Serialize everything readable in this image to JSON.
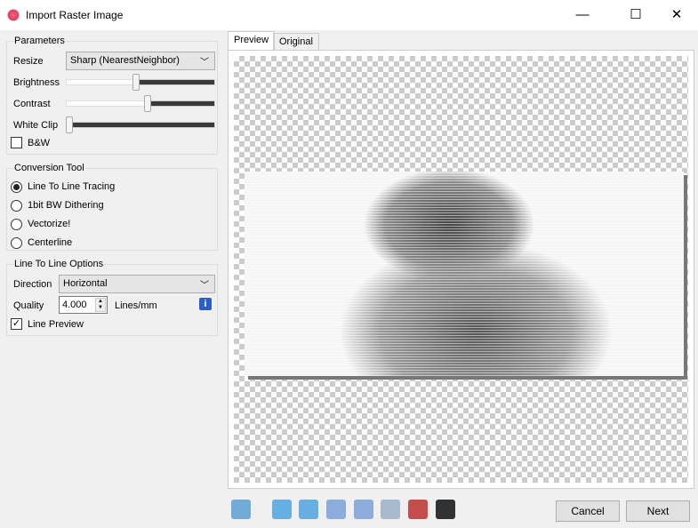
{
  "window": {
    "title": "Import Raster Image",
    "minimize": "—",
    "maximize": "☐",
    "close": "✕"
  },
  "parameters": {
    "label": "Parameters",
    "resize_label": "Resize",
    "resize_value": "Sharp (NearestNeighbor)",
    "brightness_label": "Brightness",
    "brightness_percent": 47,
    "contrast_label": "Contrast",
    "contrast_percent": 55,
    "whiteclip_label": "White Clip",
    "whiteclip_percent": 0,
    "bw_label": "B&W",
    "bw_checked": false
  },
  "conversion": {
    "label": "Conversion Tool",
    "options": [
      "Line To Line Tracing",
      "1bit BW Dithering",
      "Vectorize!",
      "Centerline"
    ],
    "selected": 0
  },
  "line_options": {
    "label": "Line To Line Options",
    "direction_label": "Direction",
    "direction_value": "Horizontal",
    "quality_label": "Quality",
    "quality_value": "4.000",
    "quality_unit": "Lines/mm",
    "line_preview_label": "Line Preview",
    "line_preview_checked": true
  },
  "tabs": [
    "Preview",
    "Original"
  ],
  "toolbar": {
    "icons": [
      "reset-icon",
      "rotate-left-icon",
      "rotate-right-icon",
      "flip-horizontal-icon",
      "flip-vertical-icon",
      "crop-icon",
      "color-picker-icon",
      "invert-icon"
    ]
  },
  "buttons": {
    "cancel": "Cancel",
    "next": "Next"
  }
}
